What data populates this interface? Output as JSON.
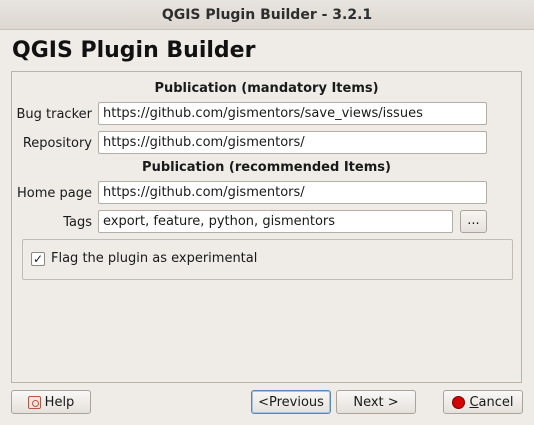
{
  "window": {
    "title": "QGIS Plugin Builder - 3.2.1"
  },
  "page": {
    "heading": "QGIS Plugin Builder"
  },
  "mandatory": {
    "title": "Publication (mandatory Items)",
    "bug_tracker": {
      "label": "Bug tracker",
      "value": "https://github.com/gismentors/save_views/issues"
    },
    "repository": {
      "label": "Repository",
      "value": "https://github.com/gismentors/"
    }
  },
  "recommended": {
    "title": "Publication (recommended Items)",
    "home_page": {
      "label": "Home page",
      "value": "https://github.com/gismentors/"
    },
    "tags": {
      "label": "Tags",
      "value": "export, feature, python, gismentors",
      "browse_label": "..."
    }
  },
  "experimental": {
    "label": "Flag the plugin as experimental",
    "checked": true,
    "check_glyph": "✓"
  },
  "buttons": {
    "help": "Help",
    "previous": "<Previous",
    "next": "Next >",
    "cancel_first": "C",
    "cancel_rest": "ancel"
  },
  "icons": {
    "help": "help-book-icon",
    "cancel": "cancel-icon"
  }
}
